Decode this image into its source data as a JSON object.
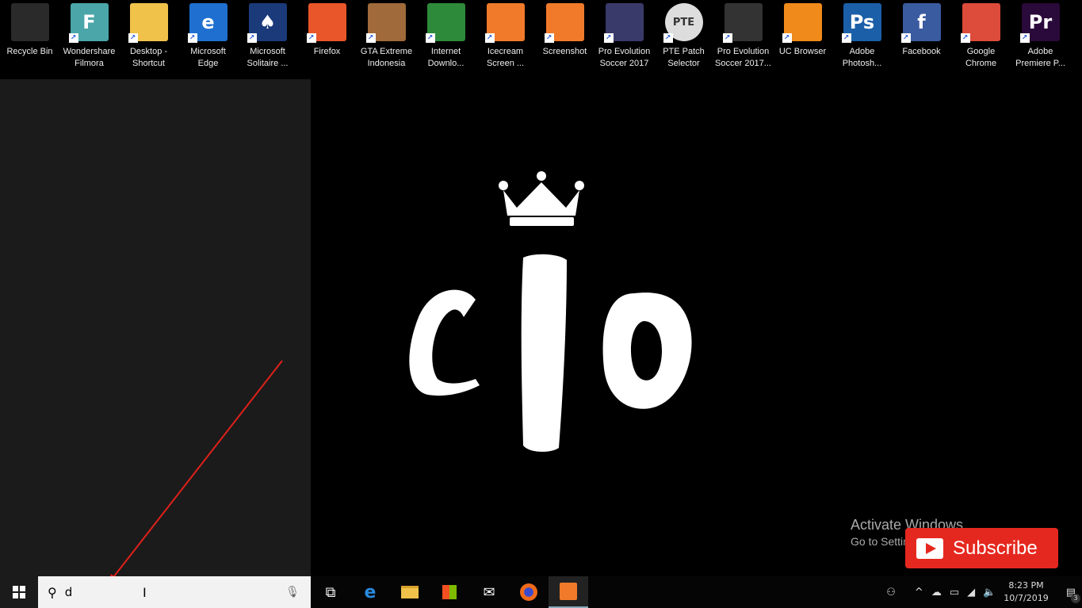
{
  "desktop_icons": [
    {
      "label": "Recycle Bin",
      "icon": "recycle-bin-icon",
      "color": "#2a2a2a"
    },
    {
      "label": "Wondershare\nFilmora",
      "icon": "filmora-icon",
      "color": "#4aa6a8",
      "glyph": "F"
    },
    {
      "label": "Desktop -\nShortcut",
      "icon": "folder-icon",
      "color": "#f0c24a"
    },
    {
      "label": "Microsoft\nEdge",
      "icon": "edge-icon",
      "color": "#1f6fd0",
      "glyph": "e"
    },
    {
      "label": "Microsoft\nSolitaire ...",
      "icon": "solitaire-icon",
      "color": "#1a3a7a",
      "glyph": "♠"
    },
    {
      "label": "Firefox",
      "icon": "firefox-icon",
      "color": "#e8562a"
    },
    {
      "label": "GTA Extreme\nIndonesia",
      "icon": "gta-icon",
      "color": "#a06a3a"
    },
    {
      "label": "Internet\nDownlo...",
      "icon": "idm-icon",
      "color": "#2d8a3a"
    },
    {
      "label": "Icecream\nScreen ...",
      "icon": "icecream-icon",
      "color": "#f07a2a"
    },
    {
      "label": "Screenshot",
      "icon": "screenshot-icon",
      "color": "#f07a2a"
    },
    {
      "label": "Pro Evolution\nSoccer 2017",
      "icon": "pes-icon",
      "color": "#3a3a6a"
    },
    {
      "label": "PTE Patch\nSelector",
      "icon": "pte-patch-icon",
      "color": "#ddd",
      "glyph": "PTE"
    },
    {
      "label": "Pro Evolution\nSoccer 2017...",
      "icon": "pes-settings-icon",
      "color": "#333"
    },
    {
      "label": "UC Browser",
      "icon": "uc-browser-icon",
      "color": "#f08a1a"
    },
    {
      "label": "Adobe\nPhotosh...",
      "icon": "photoshop-icon",
      "color": "#1b5fa8",
      "glyph": "Ps"
    },
    {
      "label": "Facebook",
      "icon": "facebook-icon",
      "color": "#3b5ba0",
      "glyph": "f"
    },
    {
      "label": "Google\nChrome",
      "icon": "chrome-icon",
      "color": "#dd4b3a"
    },
    {
      "label": "Adobe\nPremiere P...",
      "icon": "premiere-icon",
      "color": "#2a0a3a",
      "glyph": "Pr"
    }
  ],
  "search": {
    "value": "d"
  },
  "activate": {
    "title": "Activate Windows",
    "subtitle": "Go to Settings to activate Windows."
  },
  "subscribe": {
    "label": "Subscribe",
    "color": "#e5281f"
  },
  "clock": {
    "time": "8:23 PM",
    "date": "10/7/2019"
  },
  "notifications": {
    "count": "3"
  }
}
